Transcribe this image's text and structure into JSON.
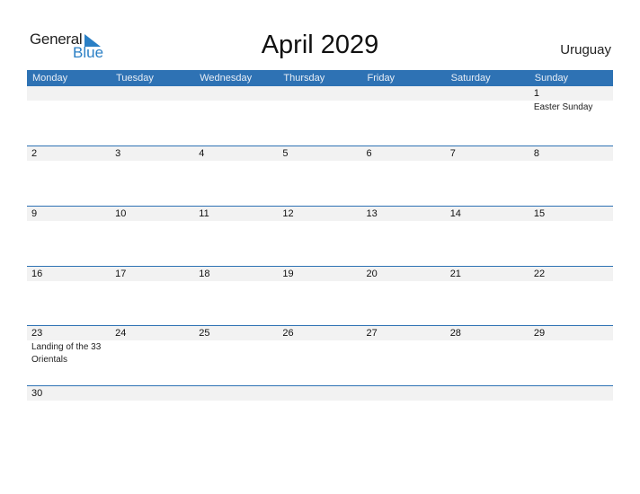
{
  "logo": {
    "general": "General",
    "blue": "Blue"
  },
  "title": "April 2029",
  "country": "Uruguay",
  "weekdays": [
    "Monday",
    "Tuesday",
    "Wednesday",
    "Thursday",
    "Friday",
    "Saturday",
    "Sunday"
  ],
  "weeks": [
    [
      {
        "d": ""
      },
      {
        "d": ""
      },
      {
        "d": ""
      },
      {
        "d": ""
      },
      {
        "d": ""
      },
      {
        "d": ""
      },
      {
        "d": "1",
        "ev": "Easter Sunday"
      }
    ],
    [
      {
        "d": "2"
      },
      {
        "d": "3"
      },
      {
        "d": "4"
      },
      {
        "d": "5"
      },
      {
        "d": "6"
      },
      {
        "d": "7"
      },
      {
        "d": "8"
      }
    ],
    [
      {
        "d": "9"
      },
      {
        "d": "10"
      },
      {
        "d": "11"
      },
      {
        "d": "12"
      },
      {
        "d": "13"
      },
      {
        "d": "14"
      },
      {
        "d": "15"
      }
    ],
    [
      {
        "d": "16"
      },
      {
        "d": "17"
      },
      {
        "d": "18"
      },
      {
        "d": "19"
      },
      {
        "d": "20"
      },
      {
        "d": "21"
      },
      {
        "d": "22"
      }
    ],
    [
      {
        "d": "23",
        "ev": "Landing of the 33 Orientals"
      },
      {
        "d": "24"
      },
      {
        "d": "25"
      },
      {
        "d": "26"
      },
      {
        "d": "27"
      },
      {
        "d": "28"
      },
      {
        "d": "29"
      }
    ],
    [
      {
        "d": "30"
      },
      {
        "d": ""
      },
      {
        "d": ""
      },
      {
        "d": ""
      },
      {
        "d": ""
      },
      {
        "d": ""
      },
      {
        "d": ""
      }
    ]
  ],
  "colors": {
    "header": "#2e72b4",
    "brand_blue": "#2a7fc5",
    "band": "#f2f2f2"
  }
}
